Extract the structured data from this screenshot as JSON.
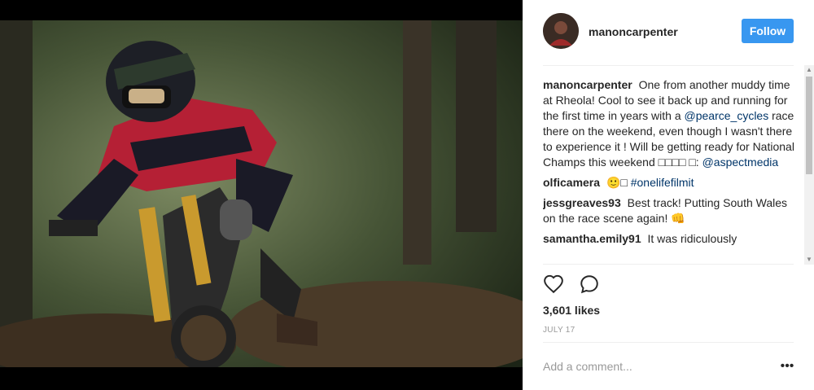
{
  "post": {
    "username": "manoncarpenter",
    "follow_label": "Follow",
    "likes": "3,601 likes",
    "date": "JULY 17",
    "comment_placeholder": "Add a comment...",
    "more_label": "•••"
  },
  "caption": {
    "username": "manoncarpenter",
    "text_1": "One from another muddy time at Rheola! Cool to see it back up and running for the first time in years with a",
    "mention_1": "@pearce_cycles",
    "text_2": "race there on the weekend, even though I wasn't there to experience it ! Will be getting ready for National Champs this weekend □□□□ □:",
    "mention_2": "@aspectmedia"
  },
  "comments": [
    {
      "username": "olficamera",
      "text": "🙂□",
      "hashtag": "#onelifefilmit"
    },
    {
      "username": "jessgreaves93",
      "text": "Best track! Putting South Wales on the race scene again! 👊"
    },
    {
      "username": "samantha.emily91",
      "text": "It was ridiculously"
    }
  ],
  "icons": {
    "like": "heart-icon",
    "comment": "speech-bubble-icon"
  },
  "colors": {
    "follow_button": "#3897f0",
    "link": "#003569",
    "muted": "#999999"
  }
}
